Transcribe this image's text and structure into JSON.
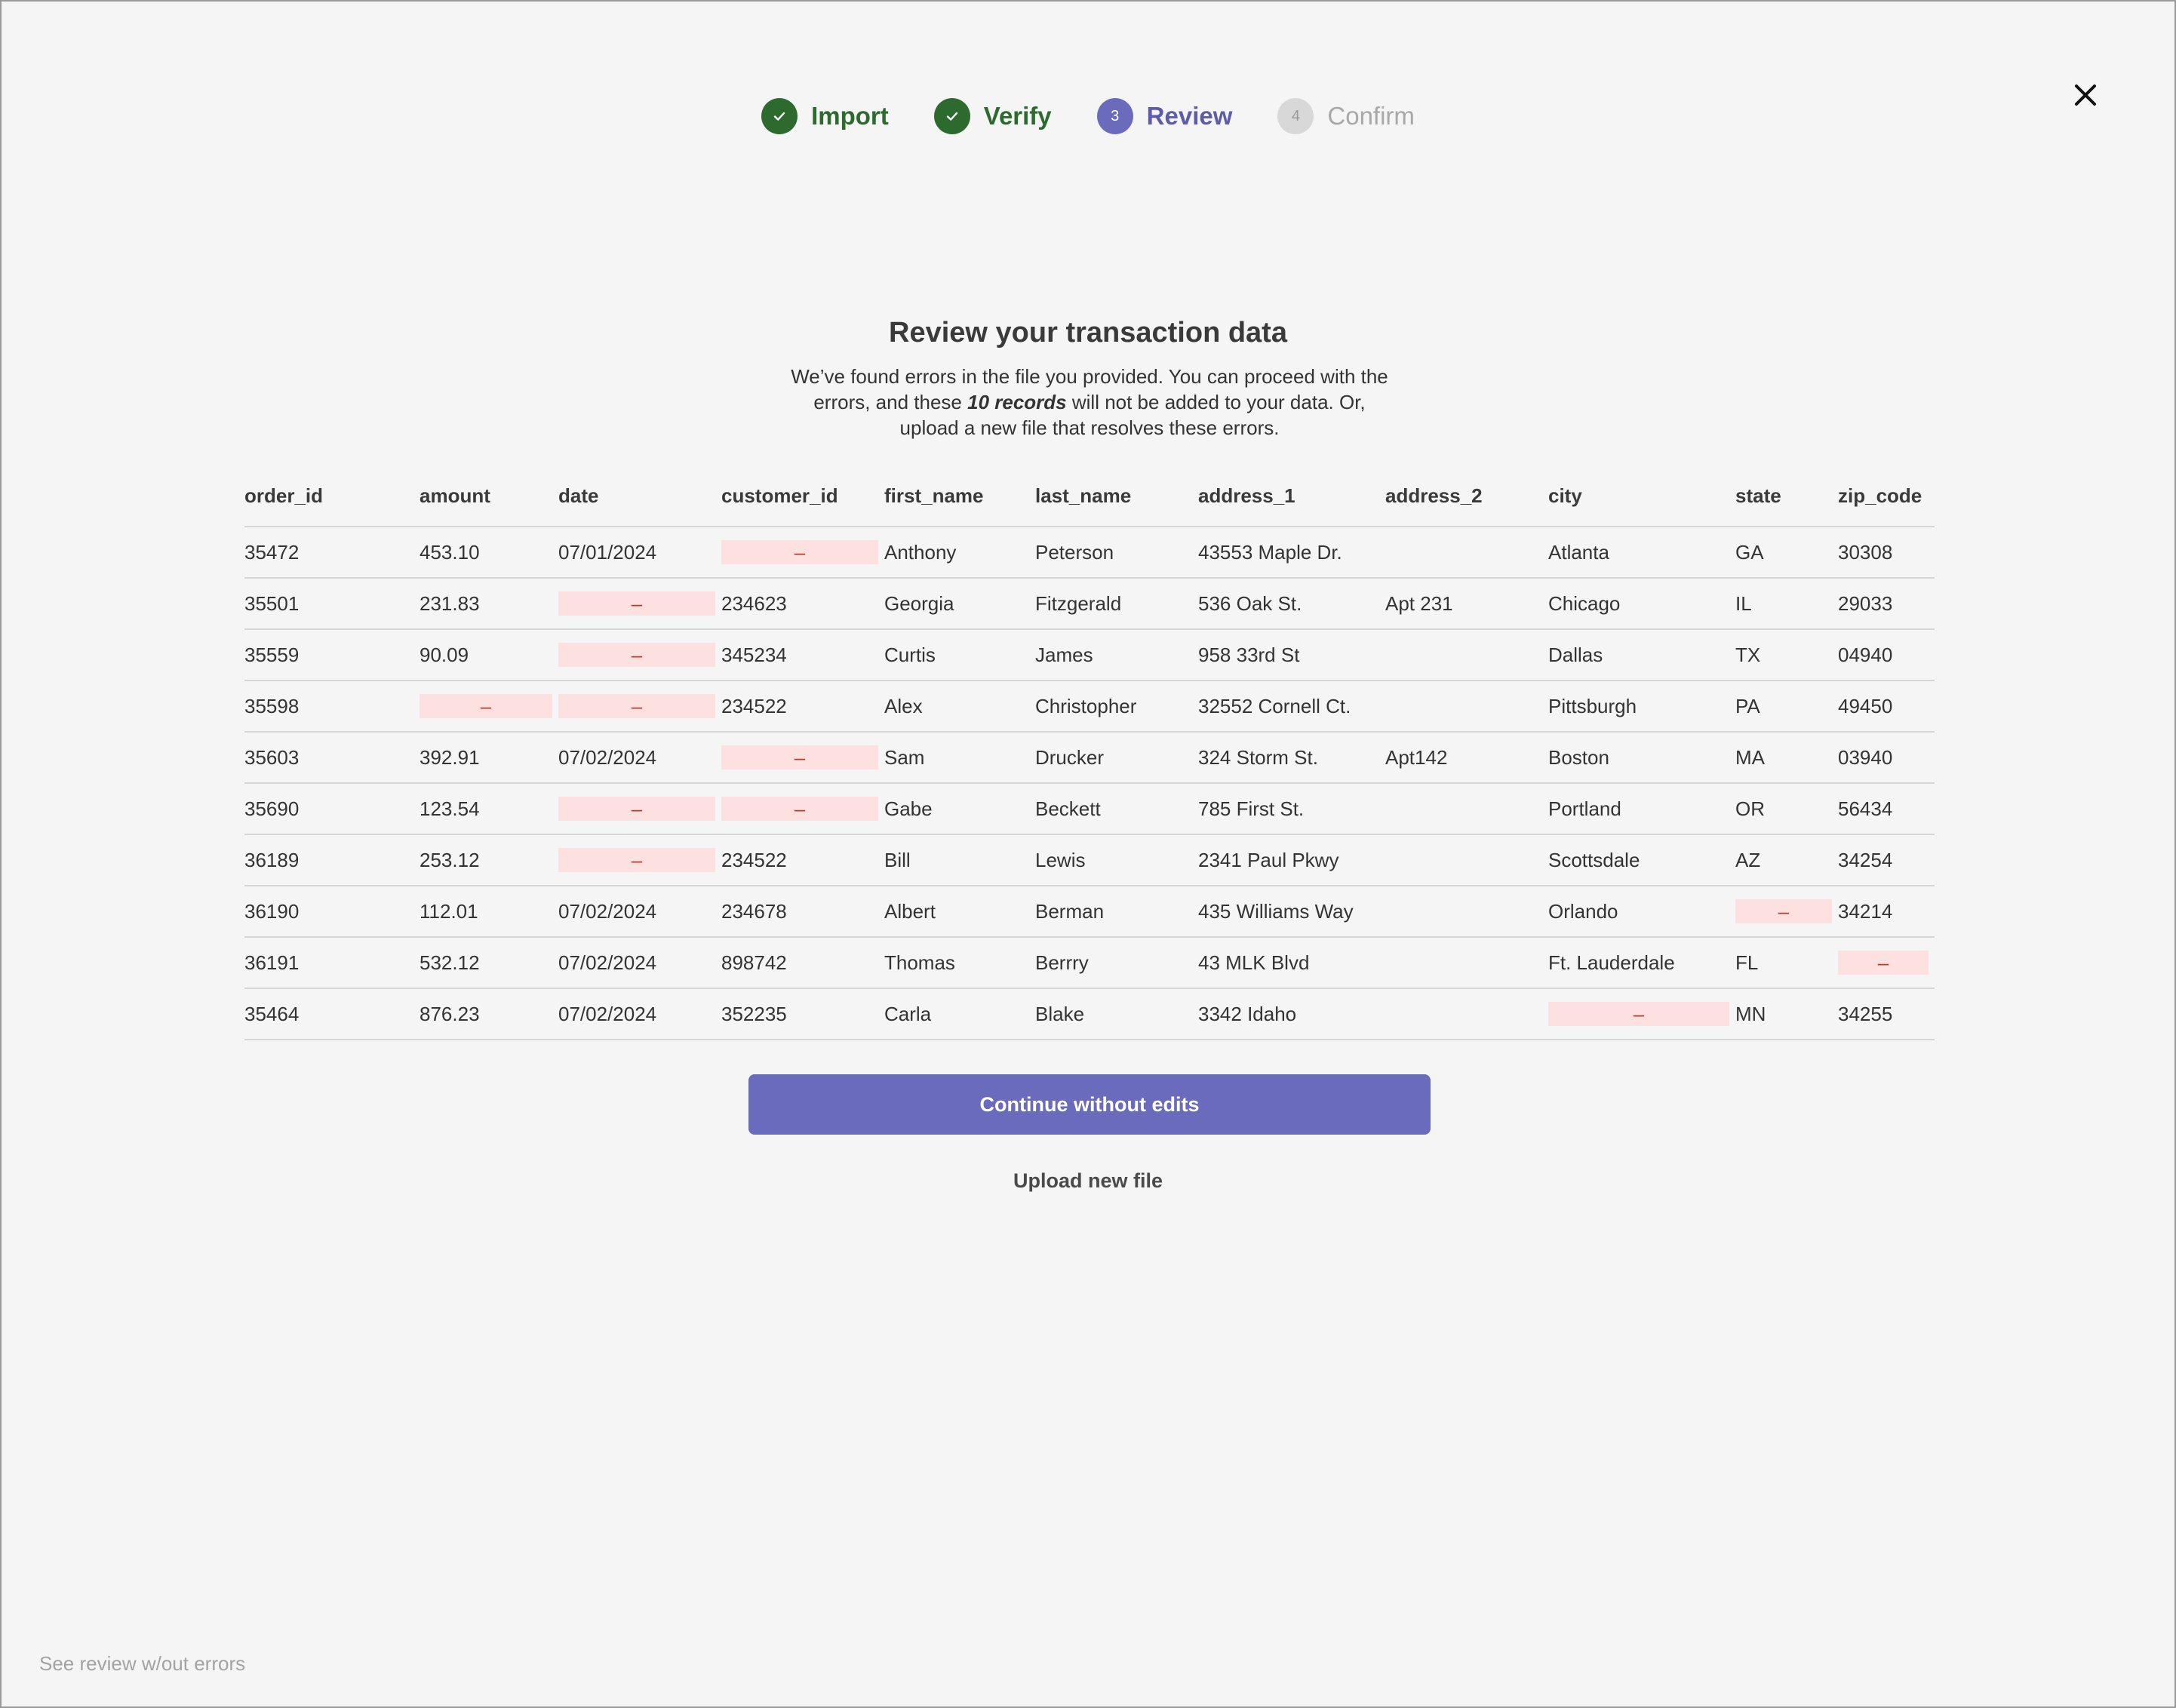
{
  "stepper": {
    "steps": [
      {
        "label": "Import",
        "status": "done",
        "number": ""
      },
      {
        "label": "Verify",
        "status": "done",
        "number": ""
      },
      {
        "label": "Review",
        "status": "active",
        "number": "3"
      },
      {
        "label": "Confirm",
        "status": "pending",
        "number": "4"
      }
    ]
  },
  "header": {
    "close_icon": "close-icon",
    "title": "Review your transaction data",
    "description_before": "We’ve found errors in the file you provided. You can proceed with the errors, and these ",
    "description_emphasis": "10 records",
    "description_after": " will not be added to your data. Or, upload a new file that resolves these errors."
  },
  "table": {
    "error_placeholder": "–",
    "columns": [
      "order_id",
      "amount",
      "date",
      "customer_id",
      "first_name",
      "last_name",
      "address_1",
      "address_2",
      "city",
      "state",
      "zip_code"
    ],
    "rows": [
      [
        "35472",
        "453.10",
        "07/01/2024",
        null,
        "Anthony",
        "Peterson",
        "43553 Maple Dr.",
        "",
        "Atlanta",
        "GA",
        "30308"
      ],
      [
        "35501",
        "231.83",
        null,
        "234623",
        "Georgia",
        "Fitzgerald",
        "536 Oak St.",
        "Apt 231",
        "Chicago",
        "IL",
        "29033"
      ],
      [
        "35559",
        "90.09",
        null,
        "345234",
        "Curtis",
        "James",
        "958 33rd St",
        "",
        "Dallas",
        "TX",
        "04940"
      ],
      [
        "35598",
        null,
        null,
        "234522",
        "Alex",
        "Christopher",
        "32552 Cornell Ct.",
        "",
        "Pittsburgh",
        "PA",
        "49450"
      ],
      [
        "35603",
        "392.91",
        "07/02/2024",
        null,
        "Sam",
        "Drucker",
        "324 Storm St.",
        "Apt142",
        "Boston",
        "MA",
        "03940"
      ],
      [
        "35690",
        "123.54",
        null,
        null,
        "Gabe",
        "Beckett",
        "785 First St.",
        "",
        "Portland",
        "OR",
        "56434"
      ],
      [
        "36189",
        "253.12",
        null,
        "234522",
        "Bill",
        "Lewis",
        "2341 Paul Pkwy",
        "",
        "Scottsdale",
        "AZ",
        "34254"
      ],
      [
        "36190",
        "112.01",
        "07/02/2024",
        "234678",
        "Albert",
        "Berman",
        "435 Williams Way",
        "",
        "Orlando",
        null,
        "34214"
      ],
      [
        "36191",
        "532.12",
        "07/02/2024",
        "898742",
        "Thomas",
        "Berrry",
        "43 MLK Blvd",
        "",
        "Ft. Lauderdale",
        "FL",
        null
      ],
      [
        "35464",
        "876.23",
        "07/02/2024",
        "352235",
        "Carla",
        "Blake",
        "3342 Idaho",
        "",
        null,
        "MN",
        "34255"
      ]
    ]
  },
  "actions": {
    "primary_label": "Continue without edits",
    "secondary_label": "Upload new file"
  },
  "footer": {
    "link_label": "See review w/out errors"
  },
  "colors": {
    "success": "#2d6a2e",
    "accent": "#6b6bbd",
    "error_bg": "#fde0e0",
    "error_text": "#c0392b"
  }
}
